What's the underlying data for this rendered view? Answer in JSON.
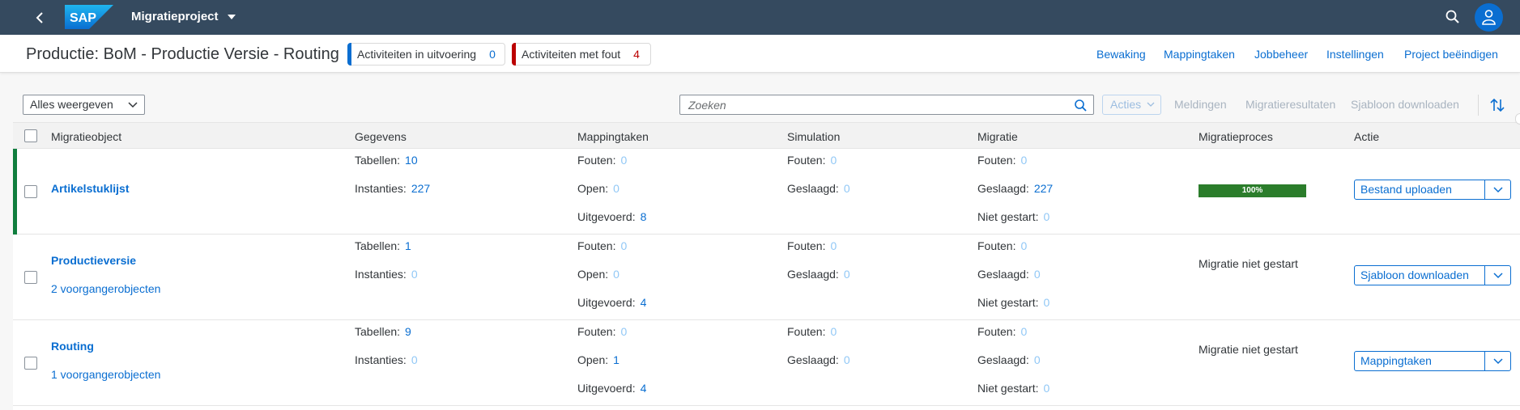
{
  "shell": {
    "logo": "SAP",
    "app_title": "Migratieproject",
    "icons": [
      "back-icon",
      "search-icon",
      "user-icon"
    ]
  },
  "header": {
    "title": "Productie: BoM - Productie Versie - Routing",
    "kpi_running_label": "Activiteiten in uitvoering",
    "kpi_running_value": "0",
    "kpi_error_label": "Activiteiten met fout",
    "kpi_error_value": "4",
    "links": [
      "Bewaking",
      "Mappingtaken",
      "Jobbeheer",
      "Instellingen",
      "Project beëindigen"
    ]
  },
  "toolbar": {
    "filter_value": "Alles weergeven",
    "search_placeholder": "Zoeken",
    "acties_label": "Acties",
    "meldingen": "Meldingen",
    "migratieresultaten": "Migratieresultaten",
    "sjabloon_downloaden": "Sjabloon downloaden"
  },
  "table": {
    "columns": [
      "Migratieobject",
      "Gegevens",
      "Mappingtaken",
      "Simulation",
      "Migratie",
      "Migratieproces",
      "Actie"
    ],
    "labels": {
      "tabellen": "Tabellen:",
      "instanties": "Instanties:",
      "fouten": "Fouten:",
      "open": "Open:",
      "uitgevoerd": "Uitgevoerd:",
      "geslaagd": "Geslaagd:",
      "niet_gestart": "Niet gestart:"
    },
    "rows": [
      {
        "name": "Artikelstuklijst",
        "predecessors": "",
        "tabellen": "10",
        "instanties": "227",
        "map_fouten": "0",
        "map_open": "0",
        "map_uitgevoerd": "8",
        "sim_fouten": "0",
        "sim_geslaagd": "0",
        "mig_fouten": "0",
        "mig_geslaagd": "227",
        "mig_niet_gestart": "0",
        "progress_label": "100%",
        "progress": 1.0,
        "status": "",
        "action": "Bestand uploaden"
      },
      {
        "name": "Productieversie",
        "predecessors": "2 voorgangerobjecten",
        "tabellen": "1",
        "instanties": "0",
        "map_fouten": "0",
        "map_open": "0",
        "map_uitgevoerd": "4",
        "sim_fouten": "0",
        "sim_geslaagd": "0",
        "mig_fouten": "0",
        "mig_geslaagd": "0",
        "mig_niet_gestart": "0",
        "status": "Migratie niet gestart",
        "action": "Sjabloon downloaden"
      },
      {
        "name": "Routing",
        "predecessors": "1 voorgangerobjecten",
        "tabellen": "9",
        "instanties": "0",
        "map_fouten": "0",
        "map_open": "1",
        "map_uitgevoerd": "4",
        "sim_fouten": "0",
        "sim_geslaagd": "0",
        "mig_fouten": "0",
        "mig_geslaagd": "0",
        "mig_niet_gestart": "0",
        "status": "Migratie niet gestart",
        "action": "Mappingtaken"
      }
    ]
  },
  "colors": {
    "shell": "#354a5f",
    "accent": "#0a6ed1",
    "success": "#107e3e",
    "error": "#bb0000"
  }
}
